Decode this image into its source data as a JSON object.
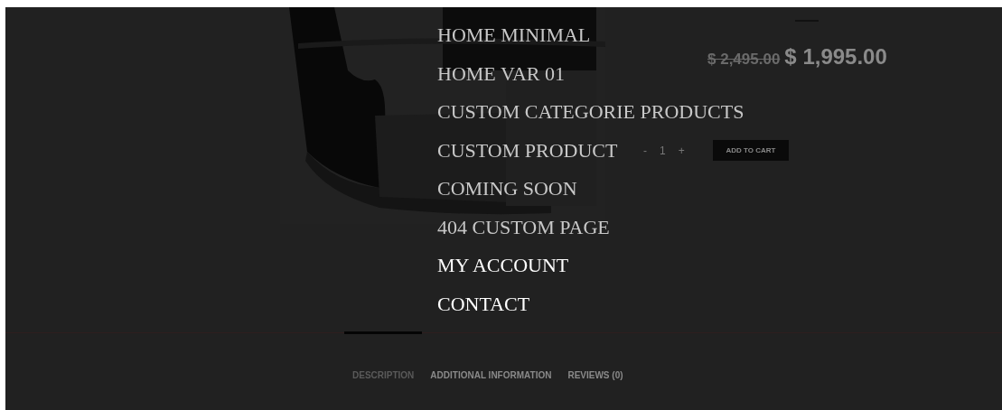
{
  "menu": {
    "items": [
      {
        "label": "HOME MINIMAL",
        "highlighted": false
      },
      {
        "label": "HOME VAR 01",
        "highlighted": false
      },
      {
        "label": "CUSTOM CATEGORIE PRODUCTS",
        "highlighted": false
      },
      {
        "label": "CUSTOM PRODUCT",
        "highlighted": false
      },
      {
        "label": "COMING SOON",
        "highlighted": false
      },
      {
        "label": "404 CUSTOM PAGE",
        "highlighted": false
      },
      {
        "label": "MY ACCOUNT",
        "highlighted": true
      },
      {
        "label": "CONTACT",
        "highlighted": true
      }
    ]
  },
  "product": {
    "kind": "picture",
    "old_price": "$ 2,495.00",
    "price": "$ 1,995.00",
    "quantity": {
      "minus": "-",
      "value": "1",
      "plus": "+"
    },
    "add_to_cart": "ADD TO CART"
  },
  "tabs": [
    {
      "label": "DESCRIPTION",
      "selected": true
    },
    {
      "label": "ADDITIONAL INFORMATION",
      "selected": false
    },
    {
      "label": "REVIEWS (0)",
      "selected": false
    }
  ]
}
